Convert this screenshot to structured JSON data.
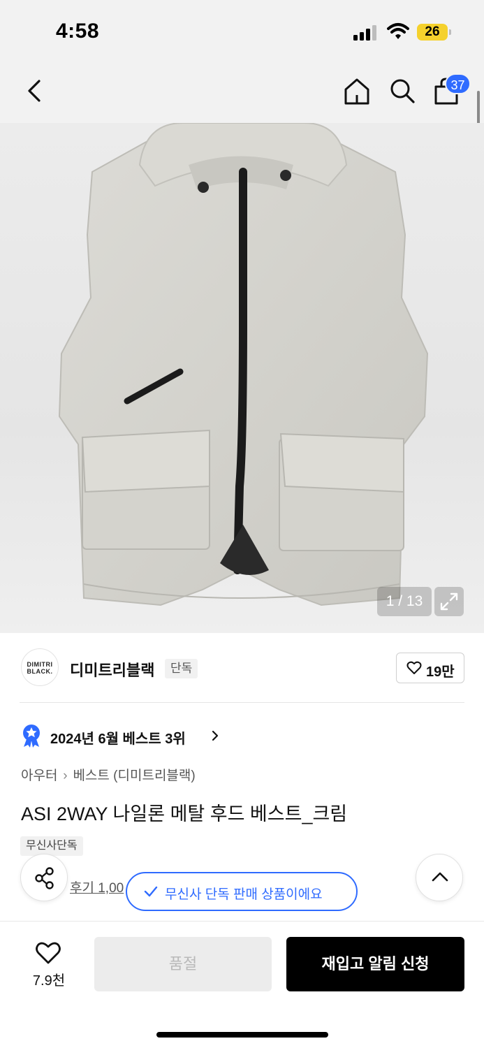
{
  "status_bar": {
    "time": "4:58",
    "battery": "26"
  },
  "nav": {
    "cart_count": "37",
    "icons": [
      "back-icon",
      "home-icon",
      "search-icon",
      "shopping-bag-icon"
    ]
  },
  "gallery": {
    "counter": "1 / 13",
    "garment_color": "#d9d8d3",
    "zipper_color": "#1b1b1b"
  },
  "brand": {
    "logo_line1": "DIMITRI",
    "logo_line2": "BLACK.",
    "name": "디미트리블랙",
    "badge": "단독",
    "likes": "19만"
  },
  "ranking": {
    "text": "2024년 6월 베스트 3위",
    "badge_color": "#2f6bff"
  },
  "breadcrumb": {
    "category": "아우터",
    "subcategory": "베스트 (디미트리블랙)"
  },
  "product": {
    "title": "ASI 2WAY 나일론 메탈 후드 베스트_크림",
    "tag": "무신사단독",
    "review_text": "후기 1,00"
  },
  "toast": {
    "text": "무신사 단독 판매 상품이에요",
    "color": "#2f6bff"
  },
  "bottom_bar": {
    "wishlist_count": "7.9천",
    "soldout_label": "품절",
    "restock_label": "재입고 알림 신청"
  }
}
